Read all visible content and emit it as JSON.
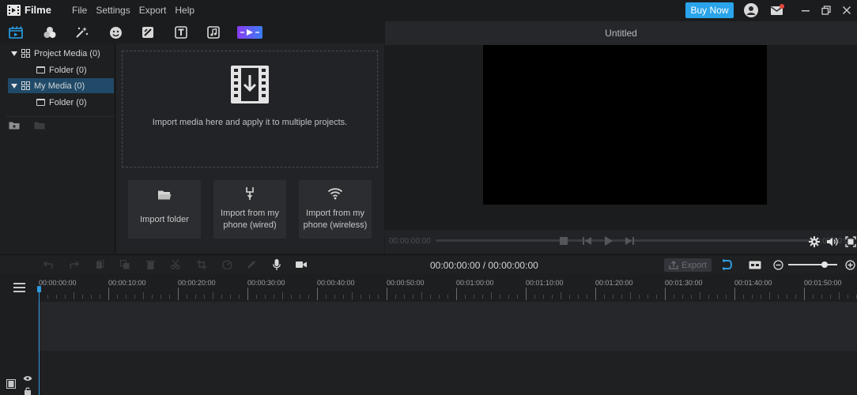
{
  "app": {
    "name": "Filme",
    "menu": [
      "File",
      "Settings",
      "Export",
      "Help"
    ],
    "buy_label": "Buy Now"
  },
  "colors": {
    "accent": "#2aa4ea",
    "selected": "#204a68",
    "playhead": "#2e9be0",
    "notification": "#e5473d"
  },
  "toolbar_icons": [
    "media-icon",
    "effects-icon",
    "filters-icon",
    "stickers-icon",
    "transitions-icon",
    "text-icon",
    "music-icon",
    "templates-icon"
  ],
  "tree": {
    "project_media": "Project Media (0)",
    "project_folder": "Folder (0)",
    "my_media": "My Media (0)",
    "my_folder": "Folder (0)"
  },
  "import": {
    "drop_text": "Import media here and apply it to multiple projects.",
    "folder_label": "Import folder",
    "wired_line1": "Import from my",
    "wired_line2": "phone (wired)",
    "wireless_line1": "Import from my",
    "wireless_line2": "phone (wireless)"
  },
  "preview": {
    "title": "Untitled",
    "time_left": "00:00:00:00",
    "time_right": "00:00:00:00"
  },
  "timeline": {
    "timecode": "00:00:00:00 / 00:00:00:00",
    "export_label": "Export",
    "ruler_labels": [
      "00:00:00:00",
      "00:00:10:00",
      "00:00:20:00",
      "00:00:30:00",
      "00:00:40:00",
      "00:00:50:00",
      "00:01:00:00",
      "00:01:10:00",
      "00:01:20:00",
      "00:01:30:00",
      "00:01:40:00",
      "00:01:50:00"
    ]
  }
}
